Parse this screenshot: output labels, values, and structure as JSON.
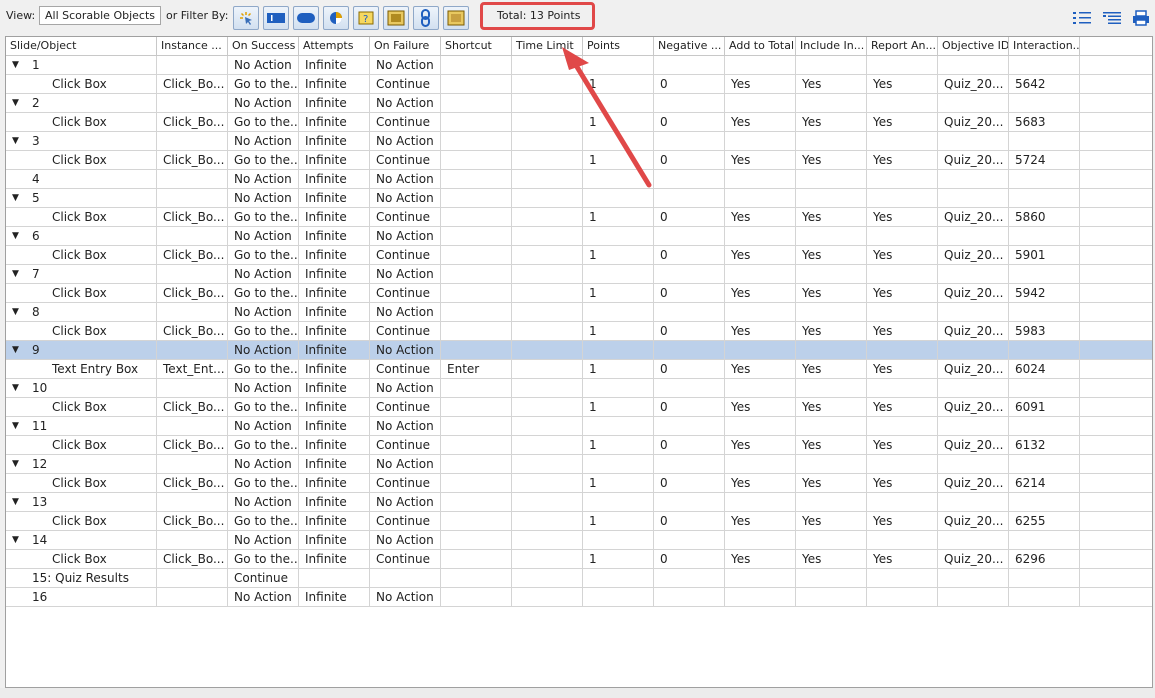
{
  "toolbar": {
    "view_label": "View:",
    "view_value": "All Scorable Objects",
    "filter_label": "or Filter By:",
    "total_text": "Total: 13 Points",
    "filter_buttons": [
      "click-box-filter",
      "text-entry-box-filter",
      "button-filter",
      "chart-filter",
      "question-filter",
      "image-filter",
      "link-filter",
      "hotspot-filter"
    ]
  },
  "columns": [
    "Slide/Object",
    "Instance ...",
    "On Success",
    "Attempts",
    "On Failure",
    "Shortcut",
    "Time Limit",
    "Points",
    "Negative ...",
    "Add to Total",
    "Include In...",
    "Report An...",
    "Objective ID",
    "Interaction..."
  ],
  "rows": [
    {
      "type": "slide",
      "expand": true,
      "cells": [
        "1",
        "",
        "No Action",
        "Infinite",
        "No Action",
        "",
        "",
        "",
        "",
        "",
        "",
        "",
        "",
        ""
      ]
    },
    {
      "type": "object",
      "cells": [
        "Click Box",
        "Click_Bo...",
        "Go to the...",
        "Infinite",
        "Continue",
        "",
        "",
        "1",
        "0",
        "Yes",
        "Yes",
        "Yes",
        "Quiz_20...",
        "5642"
      ]
    },
    {
      "type": "slide",
      "expand": true,
      "cells": [
        "2",
        "",
        "No Action",
        "Infinite",
        "No Action",
        "",
        "",
        "",
        "",
        "",
        "",
        "",
        "",
        ""
      ]
    },
    {
      "type": "object",
      "cells": [
        "Click Box",
        "Click_Bo...",
        "Go to the...",
        "Infinite",
        "Continue",
        "",
        "",
        "1",
        "0",
        "Yes",
        "Yes",
        "Yes",
        "Quiz_20...",
        "5683"
      ]
    },
    {
      "type": "slide",
      "expand": true,
      "cells": [
        "3",
        "",
        "No Action",
        "Infinite",
        "No Action",
        "",
        "",
        "",
        "",
        "",
        "",
        "",
        "",
        ""
      ]
    },
    {
      "type": "object",
      "cells": [
        "Click Box",
        "Click_Bo...",
        "Go to the...",
        "Infinite",
        "Continue",
        "",
        "",
        "1",
        "0",
        "Yes",
        "Yes",
        "Yes",
        "Quiz_20...",
        "5724"
      ]
    },
    {
      "type": "slide",
      "expand": false,
      "cells": [
        "4",
        "",
        "No Action",
        "Infinite",
        "No Action",
        "",
        "",
        "",
        "",
        "",
        "",
        "",
        "",
        ""
      ]
    },
    {
      "type": "slide",
      "expand": true,
      "cells": [
        "5",
        "",
        "No Action",
        "Infinite",
        "No Action",
        "",
        "",
        "",
        "",
        "",
        "",
        "",
        "",
        ""
      ]
    },
    {
      "type": "object",
      "cells": [
        "Click Box",
        "Click_Bo...",
        "Go to the...",
        "Infinite",
        "Continue",
        "",
        "",
        "1",
        "0",
        "Yes",
        "Yes",
        "Yes",
        "Quiz_20...",
        "5860"
      ]
    },
    {
      "type": "slide",
      "expand": true,
      "cells": [
        "6",
        "",
        "No Action",
        "Infinite",
        "No Action",
        "",
        "",
        "",
        "",
        "",
        "",
        "",
        "",
        ""
      ]
    },
    {
      "type": "object",
      "cells": [
        "Click Box",
        "Click_Bo...",
        "Go to the...",
        "Infinite",
        "Continue",
        "",
        "",
        "1",
        "0",
        "Yes",
        "Yes",
        "Yes",
        "Quiz_20...",
        "5901"
      ]
    },
    {
      "type": "slide",
      "expand": true,
      "cells": [
        "7",
        "",
        "No Action",
        "Infinite",
        "No Action",
        "",
        "",
        "",
        "",
        "",
        "",
        "",
        "",
        ""
      ]
    },
    {
      "type": "object",
      "cells": [
        "Click Box",
        "Click_Bo...",
        "Go to the...",
        "Infinite",
        "Continue",
        "",
        "",
        "1",
        "0",
        "Yes",
        "Yes",
        "Yes",
        "Quiz_20...",
        "5942"
      ]
    },
    {
      "type": "slide",
      "expand": true,
      "cells": [
        "8",
        "",
        "No Action",
        "Infinite",
        "No Action",
        "",
        "",
        "",
        "",
        "",
        "",
        "",
        "",
        ""
      ]
    },
    {
      "type": "object",
      "cells": [
        "Click Box",
        "Click_Bo...",
        "Go to the...",
        "Infinite",
        "Continue",
        "",
        "",
        "1",
        "0",
        "Yes",
        "Yes",
        "Yes",
        "Quiz_20...",
        "5983"
      ]
    },
    {
      "type": "slide",
      "expand": true,
      "selected": true,
      "cells": [
        "9",
        "",
        "No Action",
        "Infinite",
        "No Action",
        "",
        "",
        "",
        "",
        "",
        "",
        "",
        "",
        ""
      ]
    },
    {
      "type": "object",
      "cells": [
        "Text Entry Box",
        "Text_Ent...",
        "Go to the...",
        "Infinite",
        "Continue",
        "Enter",
        "",
        "1",
        "0",
        "Yes",
        "Yes",
        "Yes",
        "Quiz_20...",
        "6024"
      ]
    },
    {
      "type": "slide",
      "expand": true,
      "cells": [
        "10",
        "",
        "No Action",
        "Infinite",
        "No Action",
        "",
        "",
        "",
        "",
        "",
        "",
        "",
        "",
        ""
      ]
    },
    {
      "type": "object",
      "cells": [
        "Click Box",
        "Click_Bo...",
        "Go to the...",
        "Infinite",
        "Continue",
        "",
        "",
        "1",
        "0",
        "Yes",
        "Yes",
        "Yes",
        "Quiz_20...",
        "6091"
      ]
    },
    {
      "type": "slide",
      "expand": true,
      "cells": [
        "11",
        "",
        "No Action",
        "Infinite",
        "No Action",
        "",
        "",
        "",
        "",
        "",
        "",
        "",
        "",
        ""
      ]
    },
    {
      "type": "object",
      "cells": [
        "Click Box",
        "Click_Bo...",
        "Go to the...",
        "Infinite",
        "Continue",
        "",
        "",
        "1",
        "0",
        "Yes",
        "Yes",
        "Yes",
        "Quiz_20...",
        "6132"
      ]
    },
    {
      "type": "slide",
      "expand": true,
      "cells": [
        "12",
        "",
        "No Action",
        "Infinite",
        "No Action",
        "",
        "",
        "",
        "",
        "",
        "",
        "",
        "",
        ""
      ]
    },
    {
      "type": "object",
      "cells": [
        "Click Box",
        "Click_Bo...",
        "Go to the...",
        "Infinite",
        "Continue",
        "",
        "",
        "1",
        "0",
        "Yes",
        "Yes",
        "Yes",
        "Quiz_20...",
        "6214"
      ]
    },
    {
      "type": "slide",
      "expand": true,
      "cells": [
        "13",
        "",
        "No Action",
        "Infinite",
        "No Action",
        "",
        "",
        "",
        "",
        "",
        "",
        "",
        "",
        ""
      ]
    },
    {
      "type": "object",
      "cells": [
        "Click Box",
        "Click_Bo...",
        "Go to the...",
        "Infinite",
        "Continue",
        "",
        "",
        "1",
        "0",
        "Yes",
        "Yes",
        "Yes",
        "Quiz_20...",
        "6255"
      ]
    },
    {
      "type": "slide",
      "expand": true,
      "cells": [
        "14",
        "",
        "No Action",
        "Infinite",
        "No Action",
        "",
        "",
        "",
        "",
        "",
        "",
        "",
        "",
        ""
      ]
    },
    {
      "type": "object",
      "cells": [
        "Click Box",
        "Click_Bo...",
        "Go to the...",
        "Infinite",
        "Continue",
        "",
        "",
        "1",
        "0",
        "Yes",
        "Yes",
        "Yes",
        "Quiz_20...",
        "6296"
      ]
    },
    {
      "type": "slide",
      "expand": false,
      "cells": [
        "15: Quiz Results",
        "",
        "Continue",
        "",
        "",
        "",
        "",
        "",
        "",
        "",
        "",
        "",
        "",
        ""
      ]
    },
    {
      "type": "slide",
      "expand": false,
      "cells": [
        "16",
        "",
        "No Action",
        "Infinite",
        "No Action",
        "",
        "",
        "",
        "",
        "",
        "",
        "",
        "",
        ""
      ]
    }
  ],
  "icons": {
    "right": [
      "indent-list-icon",
      "outdent-list-icon",
      "print-icon"
    ]
  },
  "colors": {
    "highlight": "#e04848",
    "selected_row": "#bcd0ea"
  }
}
